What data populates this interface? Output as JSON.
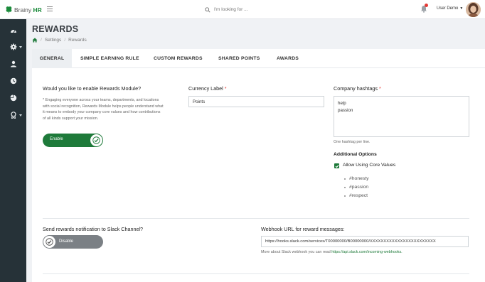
{
  "header": {
    "brand_prefix": "Brainy",
    "brand_suffix": "HR",
    "search_placeholder": "I'm looking for ...",
    "user_name": "User Demo",
    "icons": [
      "menu-icon",
      "search-icon",
      "bell-icon"
    ]
  },
  "sidebar": {
    "items": [
      {
        "icon": "dashboard-icon"
      },
      {
        "icon": "gear-icon",
        "has_caret": true
      },
      {
        "icon": "user-icon"
      },
      {
        "icon": "clock-icon"
      },
      {
        "icon": "pie-chart-icon"
      },
      {
        "icon": "award-icon",
        "has_caret": true
      }
    ]
  },
  "page": {
    "title": "REWARDS",
    "breadcrumb": [
      "Settings",
      "Rewards"
    ]
  },
  "tabs": [
    "GENERAL",
    "SIMPLE EARNING RULE",
    "CUSTOM REWARDS",
    "SHARED POINTS",
    "AWARDS"
  ],
  "active_tab": "GENERAL",
  "general": {
    "enable_question": "Would you like to enable Rewards Module?",
    "enable_help_1": "* Engaging everyone across your teams, departments, and locations",
    "enable_help_2": "with social recognition, Rewards Module helps people understand what",
    "enable_help_3": "it means to embody your company core values and how contributions",
    "enable_help_4": "of all kinds support your mission.",
    "enable_toggle_label": "Enable",
    "enable_toggle_on": true,
    "currency_label": "Currency Label",
    "currency_value": "Points",
    "hashtags_label": "Company hashtags",
    "hashtags_value": "help\npassion",
    "hashtags_help": "One hashtag per line.",
    "additional_options_label": "Additional Options",
    "allow_core_values_label": "Allow Using Core Values",
    "allow_core_values_checked": true,
    "core_values": [
      "#honesty",
      "#passion",
      "#respect"
    ],
    "slack_question": "Send rewards notification to Slack Channel?",
    "slack_toggle_label": "Disable",
    "slack_toggle_on": false,
    "webhook_label": "Webhook URL for reward messages:",
    "webhook_value": "https://hooks.slack.com/services/T00000000/B00000000/XXXXXXXXXXXXXXXXXXXXXXXX",
    "webhook_note": "More about Slack webhook you can read",
    "webhook_link": "https://api.slack.com/incoming-webhooks."
  },
  "colors": {
    "brand_green": "#1e7a3a",
    "sidebar_bg": "#263238",
    "required_star": "#e53935"
  }
}
